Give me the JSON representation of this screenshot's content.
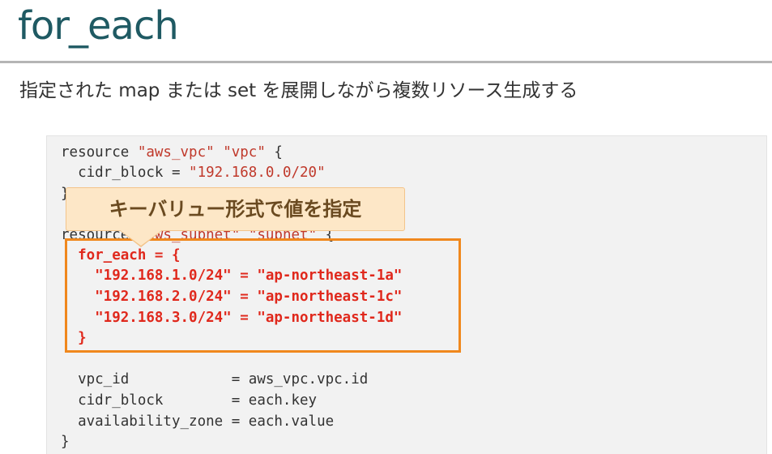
{
  "slide": {
    "title": "for_each",
    "subtitle": "指定された map または set を展開しながら複数リソース生成する"
  },
  "code": {
    "l1_kw": "resource ",
    "l1_s1": "\"aws_vpc\"",
    "l1_sp": " ",
    "l1_s2": "\"vpc\"",
    "l1_end": " {",
    "l2_key": "  cidr_block = ",
    "l2_val": "\"192.168.0.0/20\"",
    "l3": "}",
    "l4_kw": "resource ",
    "l4_s1": "\"aws_subnet\"",
    "l4_sp": " ",
    "l4_s2": "\"subnet\"",
    "l4_end": " {",
    "l5": "  for_each = {",
    "l6": "    \"192.168.1.0/24\" = \"ap-northeast-1a\"",
    "l7": "    \"192.168.2.0/24\" = \"ap-northeast-1c\"",
    "l8": "    \"192.168.3.0/24\" = \"ap-northeast-1d\"",
    "l9": "  }",
    "l10": "  vpc_id            = aws_vpc.vpc.id",
    "l11": "  cidr_block        = each.key",
    "l12": "  availability_zone = each.value",
    "l13": "}"
  },
  "callout": {
    "text": "キーバリュー形式で値を指定"
  },
  "colors": {
    "title": "#1f5a63",
    "string": "#c0392b",
    "highlight_text": "#e0281c",
    "highlight_border": "#f0881d",
    "callout_bg": "#fde7c7"
  }
}
